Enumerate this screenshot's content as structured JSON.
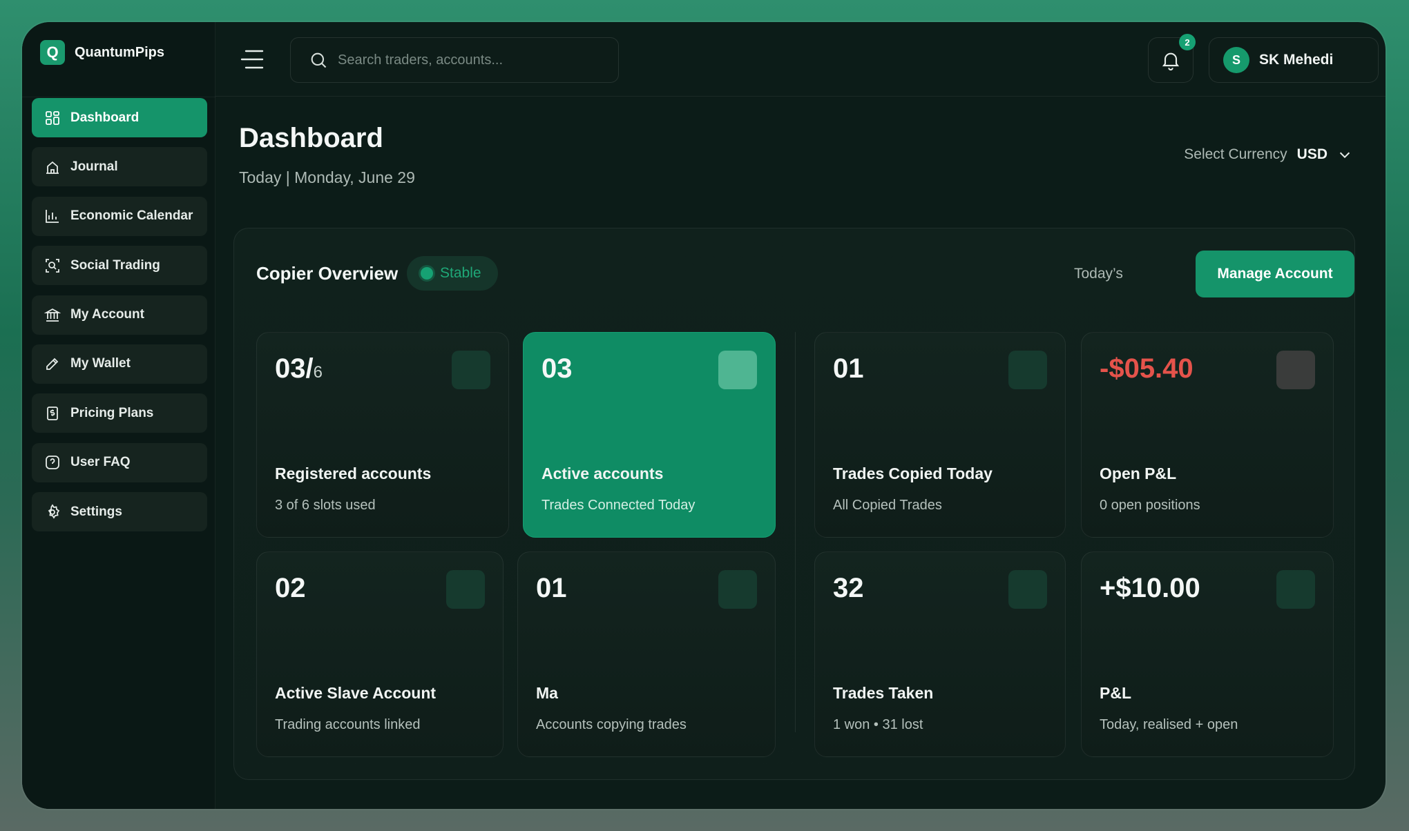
{
  "brand": {
    "logo_letter": "Q",
    "name": "QuantumPips"
  },
  "sidebar": {
    "items": [
      {
        "label": "Dashboard",
        "icon": "grid-icon",
        "active": true
      },
      {
        "label": "Journal",
        "icon": "journal-icon"
      },
      {
        "label": "Economic Calendar",
        "icon": "chart-bars-icon"
      },
      {
        "label": "Social Trading",
        "icon": "social-search-icon"
      },
      {
        "label": "My Account",
        "icon": "bank-icon"
      },
      {
        "label": "My Wallet",
        "icon": "wallet-icon"
      },
      {
        "label": "Pricing Plans",
        "icon": "dollar-doc-icon"
      },
      {
        "label": "User FAQ",
        "icon": "question-icon"
      },
      {
        "label": "Settings",
        "icon": "gear-icon"
      }
    ]
  },
  "topbar": {
    "search_placeholder": "Search traders, accounts...",
    "notifications_count": "2",
    "user_initial": "S",
    "user_name": "SK Mehedi"
  },
  "header": {
    "title": "Dashboard",
    "date": "Today | Monday, June 29",
    "currency_label": "Select Currency",
    "currency_value": "USD"
  },
  "overview": {
    "title": "Copier Overview",
    "status": "Stable",
    "period": "Today’s",
    "manage_label": "Manage Account",
    "cards": [
      {
        "value": "03/",
        "value_small": "6",
        "label": "Registered accounts",
        "sub": "3 of 6 slots used"
      },
      {
        "value": "03",
        "label": "Active accounts",
        "sub": "Trades Connected Today"
      },
      {
        "value": "01",
        "label": "Trades Copied Today",
        "sub": "All Copied Trades"
      },
      {
        "value": "-$05.40",
        "label": "Open P&L",
        "sub": "0 open positions"
      },
      {
        "value": "02",
        "label": "Active Slave Account",
        "sub": "Trading accounts linked"
      },
      {
        "value": "01",
        "label": "Ma",
        "sub": "Accounts copying trades"
      },
      {
        "value": "32",
        "label": "Trades Taken",
        "sub": "1 won  •  31 lost"
      },
      {
        "value": "+$10.00",
        "label": "P&L",
        "sub": "Today, realised + open"
      }
    ]
  },
  "colors": {
    "accent": "#15946a",
    "negative": "#e5534b",
    "background": "#0c1c18"
  }
}
